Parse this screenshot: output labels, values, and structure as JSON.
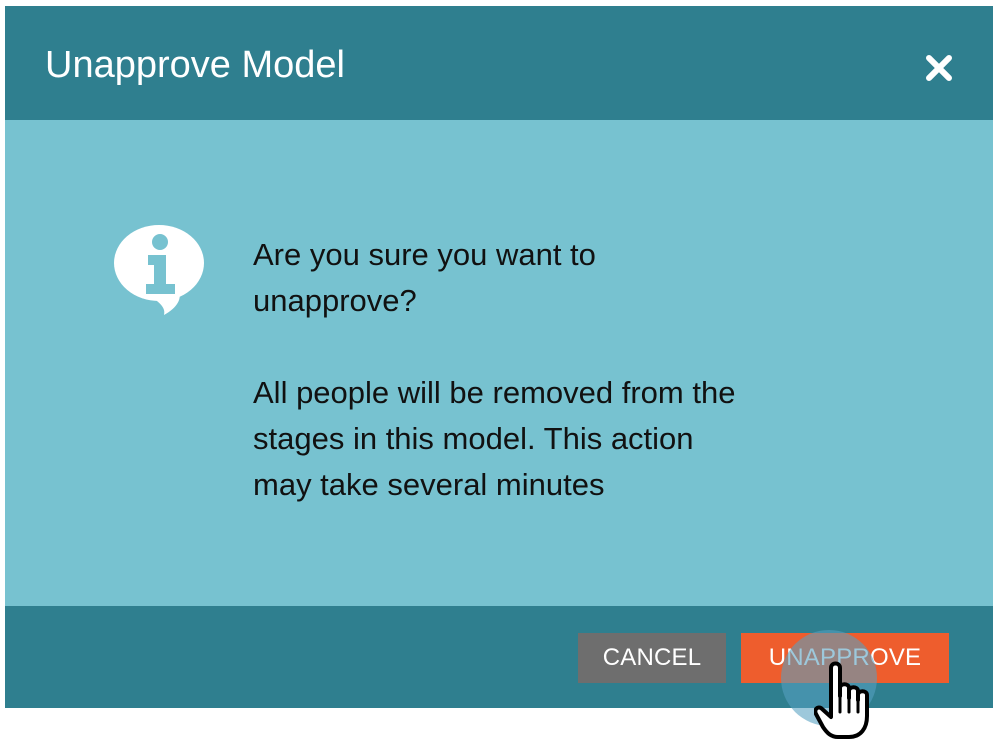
{
  "dialog": {
    "title": "Unapprove Model",
    "close_icon": "close-icon"
  },
  "body": {
    "icon": "info-speech-bubble-icon",
    "message_line_1": "Are you sure you want to",
    "message_line_2": "unapprove?",
    "message_line_3": "All people will be removed from the",
    "message_line_4": "stages in this model. This action",
    "message_line_5": "may take several minutes"
  },
  "footer": {
    "cancel_label": "CANCEL",
    "unapprove_label": "UNAPPROVE"
  },
  "cursor": {
    "icon": "pointing-hand-cursor-icon"
  },
  "colors": {
    "header_footer": "#2f7f8f",
    "body_background": "#77c2d0",
    "cancel_button": "#6e6e6e",
    "unapprove_button": "#ee5d2d",
    "text": "#111111"
  }
}
